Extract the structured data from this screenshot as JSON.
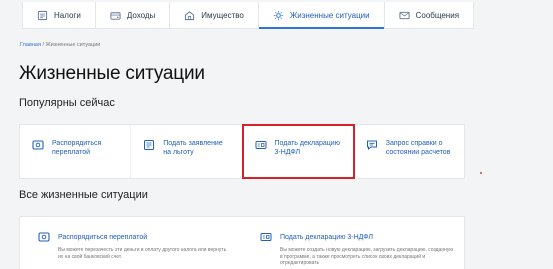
{
  "nav": {
    "tabs": [
      {
        "label": "Налоги",
        "icon": "taxes-icon",
        "active": false
      },
      {
        "label": "Доходы",
        "icon": "income-icon",
        "active": false
      },
      {
        "label": "Имущество",
        "icon": "property-icon",
        "active": false
      },
      {
        "label": "Жизненные ситуации",
        "icon": "life-situations-icon",
        "active": true
      },
      {
        "label": "Сообщения",
        "icon": "messages-icon",
        "active": false
      }
    ]
  },
  "breadcrumb": {
    "home": "Главная",
    "separator": " / ",
    "current": "Жизненные ситуации"
  },
  "page_title": "Жизненные ситуации",
  "popular": {
    "title": "Популярны сейчас",
    "cards": [
      {
        "label": "Распорядиться переплатой",
        "icon": "wallet-icon"
      },
      {
        "label": "Подать заявление на льготу",
        "icon": "document-icon"
      },
      {
        "label": "Подать декларацию 3-НДФЛ",
        "icon": "declaration-icon",
        "highlighted": true
      },
      {
        "label": "Запрос справки о состоянии расчетов",
        "icon": "chat-icon"
      }
    ]
  },
  "all": {
    "title": "Все жизненные ситуации",
    "cards": [
      {
        "label": "Распорядиться переплатой",
        "icon": "wallet-icon",
        "description": "Вы можете перезачесть эти деньги в оплату другого налога или вернуть их на свой банковский счет."
      },
      {
        "label": "Подать декларацию 3-НДФЛ",
        "icon": "declaration-icon",
        "description": "Вы можете создать новую декларацию, загрузить декларацию, созданную в программе, а также просмотреть список своих деклараций и отредактировать"
      }
    ]
  },
  "colors": {
    "accent": "#2f74d0",
    "link": "#2160b8",
    "highlight": "#d6202a"
  }
}
